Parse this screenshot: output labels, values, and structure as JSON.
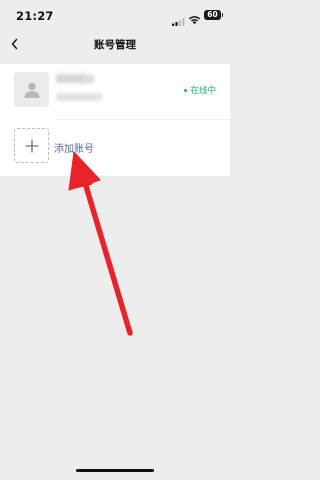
{
  "status_bar": {
    "time": "21:27",
    "battery": "60",
    "icons": [
      "signal-icon",
      "wifi-icon",
      "battery-icon"
    ]
  },
  "nav": {
    "title": "账号管理",
    "back_icon": "chevron-left-icon"
  },
  "accounts": [
    {
      "status": "在线中",
      "status_color": "#2aae67",
      "avatar_icon": "person-icon"
    }
  ],
  "add_account": {
    "label": "添加账号",
    "label_color": "#576b95",
    "icon": "plus-icon"
  },
  "annotation": {
    "color": "#e8232a",
    "icon": "red-arrow-icon"
  }
}
